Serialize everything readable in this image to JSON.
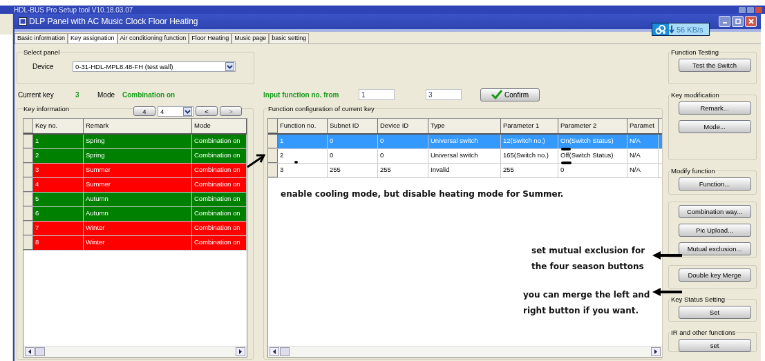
{
  "outer_window": {
    "title": "HDL-BUS Pro Setup tool V10.18.03.07"
  },
  "window": {
    "title": "DLP Panel with AC Music Clock Floor Heating"
  },
  "download_badge": {
    "speed": "56 KB/s"
  },
  "tabs": [
    {
      "label": "Basic information",
      "selected": false
    },
    {
      "label": "Key assignation",
      "selected": true
    },
    {
      "label": "Air conditioning function",
      "selected": false
    },
    {
      "label": "Floor Heating",
      "selected": false
    },
    {
      "label": "Music page",
      "selected": false
    },
    {
      "label": "basic setting",
      "selected": false
    }
  ],
  "select_panel": {
    "legend": "Select panel",
    "device_label": "Device",
    "device_value": "0-31-HDL-MPL8.48-FH (test wall)"
  },
  "current_key": {
    "label": "Current key",
    "value": "3",
    "mode_label": "Mode",
    "mode_value": "Combination on"
  },
  "input_function": {
    "label": "Input function no. from",
    "from": "1",
    "to": "3",
    "confirm": "Confirm"
  },
  "key_information": {
    "legend": "Key information",
    "page_button": "4",
    "page_select": "4",
    "prev": "<",
    "next": ">",
    "next_disabled": true,
    "columns": [
      "Key no.",
      "Remark",
      "Mode"
    ],
    "rows": [
      {
        "key_no": "1",
        "remark": "Spring",
        "mode": "Combination on",
        "color": "#008000"
      },
      {
        "key_no": "2",
        "remark": "Spring",
        "mode": "Combination on",
        "color": "#008000"
      },
      {
        "key_no": "3",
        "remark": "Summer",
        "mode": "Combination on",
        "color": "#ff0000"
      },
      {
        "key_no": "4",
        "remark": "Summer",
        "mode": "Combination on",
        "color": "#ff0000"
      },
      {
        "key_no": "5",
        "remark": "Autumn",
        "mode": "Combination on",
        "color": "#008000"
      },
      {
        "key_no": "6",
        "remark": "Autumn",
        "mode": "Combination on",
        "color": "#008000"
      },
      {
        "key_no": "7",
        "remark": "Winter",
        "mode": "Combination on",
        "color": "#ff0000"
      },
      {
        "key_no": "8",
        "remark": "Winter",
        "mode": "Combination on",
        "color": "#ff0000"
      }
    ]
  },
  "function_config": {
    "legend": "Function configuration of current key",
    "columns": [
      "Function no.",
      "Subnet ID",
      "Device ID",
      "Type",
      "Parameter 1",
      "Parameter 2",
      "Paramet"
    ],
    "rows": [
      {
        "cells": [
          "1",
          "0",
          "0",
          "Universal switch",
          "12(Switch no.)",
          "On(Switch Status)",
          "N/A"
        ],
        "selected": true
      },
      {
        "cells": [
          "2",
          "0",
          "0",
          "Universal switch",
          "165(Switch no.)",
          "Off(Switch Status)",
          "N/A"
        ],
        "selected": false
      },
      {
        "cells": [
          "3",
          "255",
          "255",
          "Invalid",
          "255",
          "0",
          "N/A"
        ],
        "selected": false
      }
    ]
  },
  "side_panel": [
    {
      "legend": "Function Testing",
      "buttons": [
        "Test the Switch"
      ]
    },
    {
      "legend": "Key modification",
      "buttons": [
        "Remark...",
        "Mode..."
      ]
    },
    {
      "legend": "Modify function",
      "buttons": [
        "Function..."
      ]
    },
    {
      "buttons": [
        "Combination way...",
        "Pic Upload...",
        "Mutual exclusion..."
      ]
    },
    {
      "buttons": [
        "Double key Merge"
      ]
    },
    {
      "legend": "Key Status Setting",
      "buttons": [
        "Set"
      ]
    },
    {
      "legend": "IR and other functions",
      "buttons": [
        "set"
      ]
    }
  ],
  "annotations": [
    {
      "lines": [
        "enable cooling mode, but disable heating mode for Summer."
      ]
    },
    {
      "lines": [
        "set mutual exclusion for",
        "the four season buttons"
      ]
    },
    {
      "lines": [
        "you can merge the left and",
        "right button if you want."
      ]
    }
  ]
}
